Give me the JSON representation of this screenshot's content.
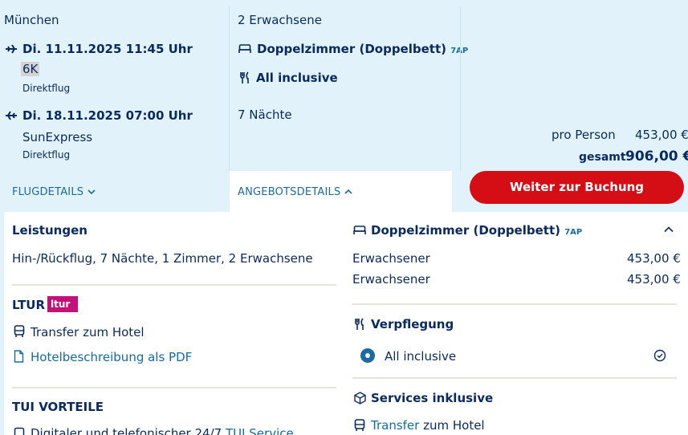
{
  "flight": {
    "departure_city": "München",
    "outbound": {
      "datetime": "Di. 11.11.2025 11:45 Uhr",
      "airline": "6K",
      "type": "Direktflug"
    },
    "return": {
      "datetime": "Di. 18.11.2025 07:00 Uhr",
      "airline": "SunExpress",
      "type": "Direktflug"
    },
    "details_link": "FLUGDETAILS"
  },
  "offer": {
    "travellers": "2 Erwachsene",
    "room": "Doppelzimmer (Doppelbett)",
    "room_code": "7AP",
    "board": "All inclusive",
    "nights": "7 Nächte",
    "details_link": "ANGEBOTSDETAILS"
  },
  "price": {
    "per_person_label": "pro Person",
    "per_person_value": "453,00 €",
    "total_label": "gesamt",
    "total_value": "906,00 €",
    "book_button": "Weiter zur Buchung"
  },
  "details": {
    "services_heading": "Leistungen",
    "services_text": "Hin-/Rückflug, 7 Nächte, 1 Zimmer, 2 Erwachsene",
    "ltur_heading": "LTUR",
    "ltur_logo": "ltur",
    "transfer": "Transfer zum Hotel",
    "pdf_link": "Hotelbeschreibung als PDF",
    "tui_heading": "TUI VORTEILE",
    "tui_item_prefix": "Digitaler und telefonischer 24/7 ",
    "tui_item_link": "TUI Service",
    "room_heading": "Doppelzimmer (Doppelbett)",
    "room_code": "7AP",
    "price_rows": [
      {
        "label": "Erwachsener",
        "value": "453,00 €"
      },
      {
        "label": "Erwachsener",
        "value": "453,00 €"
      }
    ],
    "board_heading": "Verpflegung",
    "board_option": "All inclusive",
    "services_incl_heading": "Services inklusive",
    "services_incl_link": "Transfer",
    "services_incl_rest": " zum Hotel"
  },
  "colors": {
    "background": "#e1f2fb",
    "primary_text": "#092a5e",
    "link": "#1c6aa3",
    "button": "#d40e14",
    "ltur_badge": "#c4117a"
  }
}
